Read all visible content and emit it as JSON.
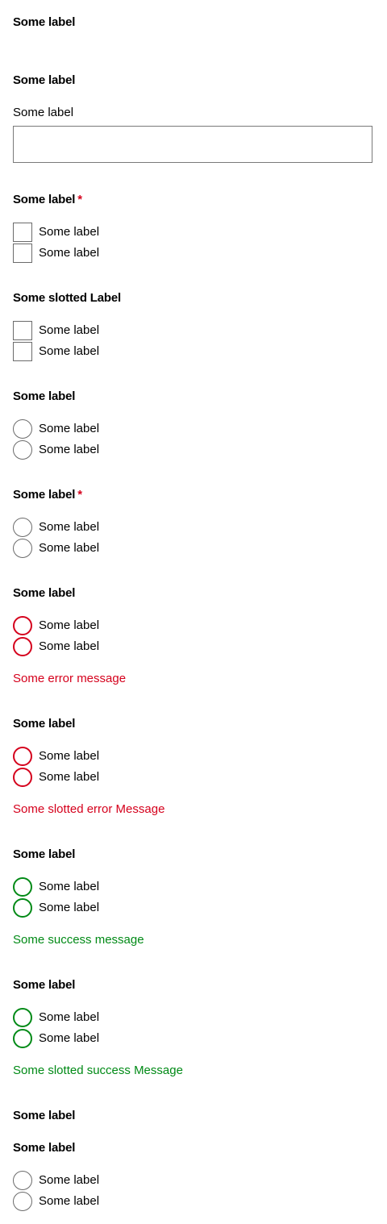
{
  "colors": {
    "error": "#d5001c",
    "success": "#018a16",
    "border": "#6b6b6b",
    "required": "#d5001c"
  },
  "section1": {
    "label": "Some label"
  },
  "section2": {
    "label": "Some label",
    "field_label": "Some label",
    "field_value": ""
  },
  "section3": {
    "label": "Some label",
    "required_marker": "*",
    "options": [
      "Some label",
      "Some label"
    ]
  },
  "section4": {
    "label": "Some slotted Label",
    "options": [
      "Some label",
      "Some label"
    ]
  },
  "section5": {
    "label": "Some label",
    "options": [
      "Some label",
      "Some label"
    ]
  },
  "section6": {
    "label": "Some label",
    "required_marker": "*",
    "options": [
      "Some label",
      "Some label"
    ]
  },
  "section7": {
    "label": "Some label",
    "options": [
      "Some label",
      "Some label"
    ],
    "message": "Some error message"
  },
  "section8": {
    "label": "Some label",
    "options": [
      "Some label",
      "Some label"
    ],
    "message": "Some slotted error Message"
  },
  "section9": {
    "label": "Some label",
    "options": [
      "Some label",
      "Some label"
    ],
    "message": "Some success message"
  },
  "section10": {
    "label": "Some label",
    "options": [
      "Some label",
      "Some label"
    ],
    "message": "Some slotted success Message"
  },
  "section11": {
    "label": "Some label"
  },
  "section12": {
    "label": "Some label",
    "options": [
      "Some label",
      "Some label"
    ]
  }
}
